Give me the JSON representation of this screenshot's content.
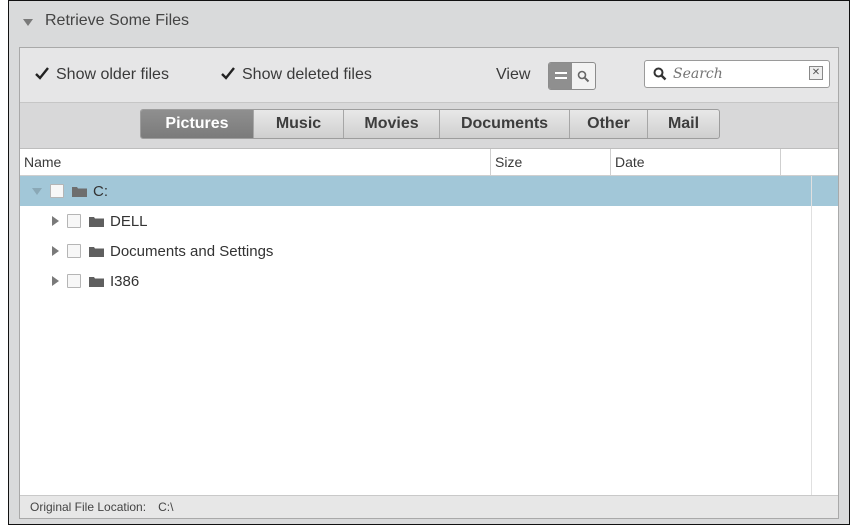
{
  "section": {
    "title": "Retrieve Some Files"
  },
  "toolbar": {
    "show_older_files": {
      "label": "Show older files",
      "checked": true
    },
    "show_deleted_files": {
      "label": "Show deleted files",
      "checked": true
    },
    "view_label": "View",
    "view_modes": [
      {
        "icon": "list-view-icon",
        "active": true
      },
      {
        "icon": "search-view-icon",
        "active": false
      }
    ],
    "search": {
      "placeholder": "Search",
      "value": "",
      "clear_icon": "clear-icon"
    }
  },
  "categories": {
    "tabs": [
      {
        "label": "Pictures",
        "active": true
      },
      {
        "label": "Music",
        "active": false
      },
      {
        "label": "Movies",
        "active": false
      },
      {
        "label": "Documents",
        "active": false
      },
      {
        "label": "Other",
        "active": false
      },
      {
        "label": "Mail",
        "active": false
      }
    ]
  },
  "table": {
    "columns": [
      "Name",
      "Size",
      "Date"
    ],
    "rows": [
      {
        "name": "C:",
        "expanded": true,
        "selected": true,
        "level": 0,
        "icon": "folder-icon"
      },
      {
        "name": "DELL",
        "expanded": false,
        "selected": false,
        "level": 1,
        "icon": "folder-icon"
      },
      {
        "name": "Documents and Settings",
        "expanded": false,
        "selected": false,
        "level": 1,
        "icon": "folder-icon"
      },
      {
        "name": "I386",
        "expanded": false,
        "selected": false,
        "level": 1,
        "icon": "folder-icon"
      }
    ]
  },
  "footer": {
    "label": "Original File Location:",
    "value": "C:\\"
  },
  "colors": {
    "selected_row": "#a2c7d8",
    "active_tab": "#858585",
    "panel_background": "#d9dadb"
  }
}
